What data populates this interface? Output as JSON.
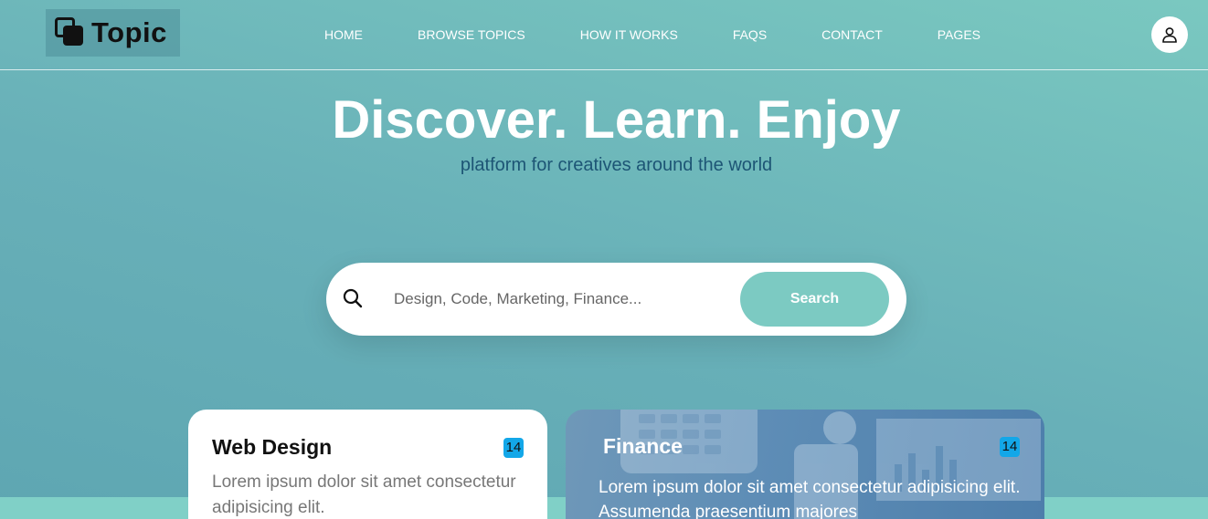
{
  "brand": {
    "name": "Topic"
  },
  "nav": {
    "items": [
      {
        "label": "HOME"
      },
      {
        "label": "BROWSE TOPICS"
      },
      {
        "label": "HOW IT WORKS"
      },
      {
        "label": "FAQS"
      },
      {
        "label": "CONTACT"
      },
      {
        "label": "PAGES"
      }
    ]
  },
  "hero": {
    "title": "Discover. Learn. Enjoy",
    "subtitle": "platform for creatives around the world"
  },
  "search": {
    "placeholder": "Design, Code, Marketing, Finance...",
    "button_label": "Search",
    "icon": "search-icon"
  },
  "cards": [
    {
      "title": "Web Design",
      "count": "14",
      "text": "Lorem ipsum dolor sit amet consectetur adipisicing elit."
    },
    {
      "title": "Finance",
      "count": "14",
      "text": "Lorem ipsum dolor sit amet consectetur adipisicing elit. Assumenda praesentium majores"
    }
  ],
  "colors": {
    "accent": "#7ccac2",
    "badge": "#13a7e8",
    "subtitle": "#1d5575"
  }
}
